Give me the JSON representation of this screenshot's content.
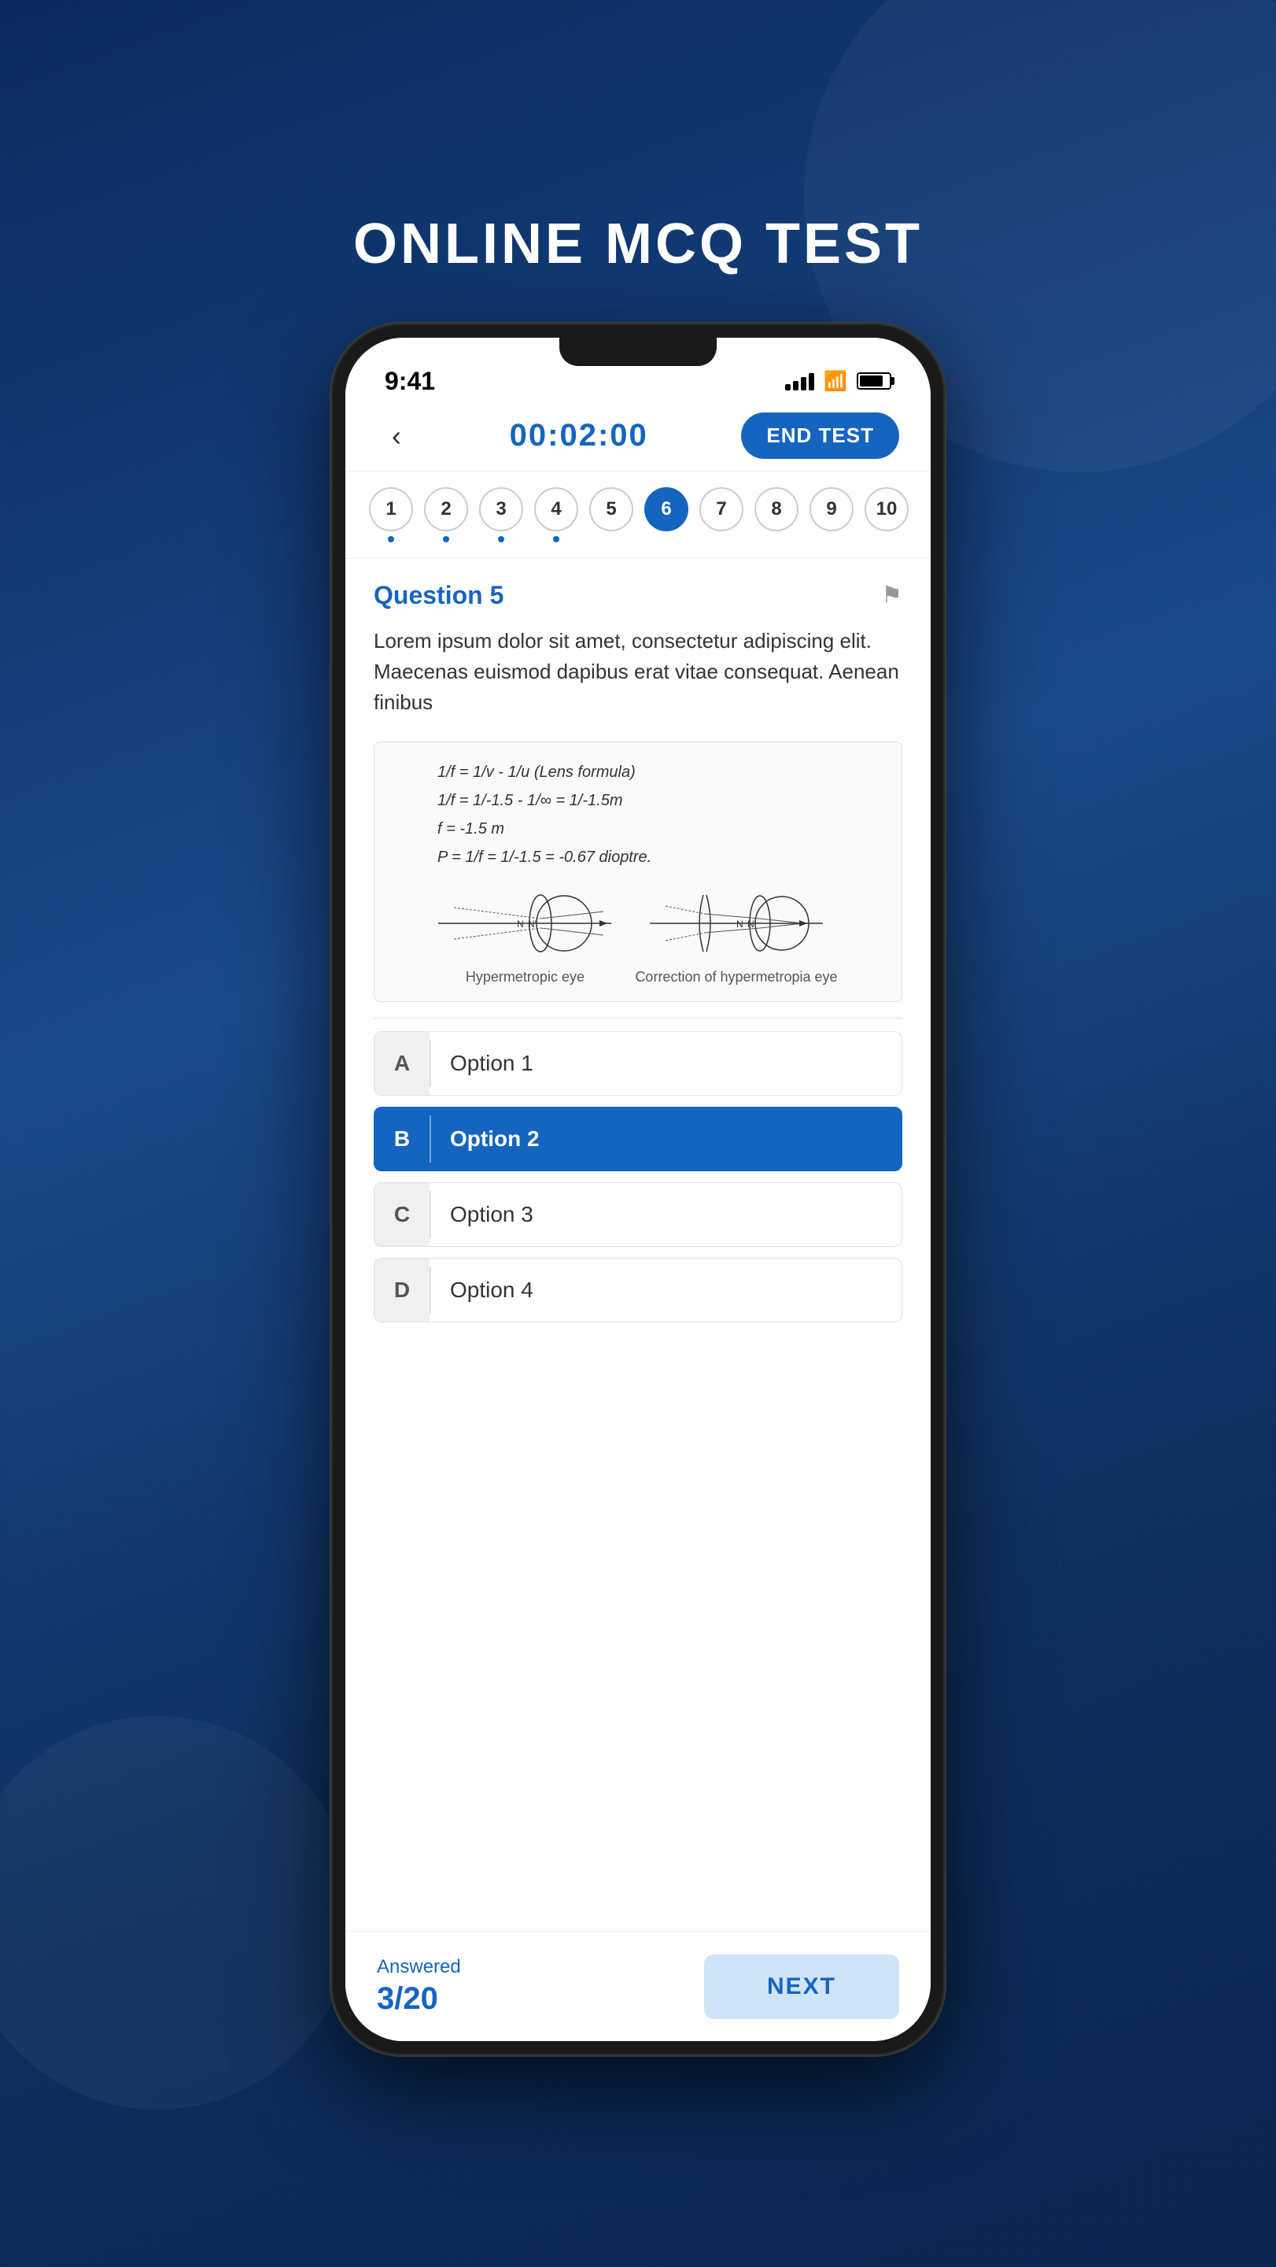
{
  "page": {
    "title": "ONLINE MCQ TEST"
  },
  "status_bar": {
    "time": "9:41"
  },
  "header": {
    "timer": "00:02:00",
    "end_test_label": "END TEST"
  },
  "question_numbers": {
    "items": [
      {
        "num": "1",
        "dot": true
      },
      {
        "num": "2",
        "dot": true
      },
      {
        "num": "3",
        "dot": true
      },
      {
        "num": "4",
        "dot": true
      },
      {
        "num": "5",
        "dot": false
      },
      {
        "num": "6",
        "dot": false,
        "active": true
      },
      {
        "num": "7",
        "dot": false
      },
      {
        "num": "8",
        "dot": false
      },
      {
        "num": "9",
        "dot": false
      },
      {
        "num": "10",
        "dot": false
      }
    ]
  },
  "question": {
    "title": "Question 5",
    "text": "Lorem ipsum dolor sit amet, consectetur adipiscing elit. Maecenas euismod dapibus erat vitae consequat. Aenean finibus",
    "formula_lines": [
      "1/f = 1/v - 1/u  (Lens formula)",
      "1/f = 1/-1.5 - 1/∞ = 1/-1.5m",
      "f = -1.5 m",
      "P = 1/f = 1/-1.5 = -0.67 dioptre."
    ],
    "diagram1_label": "Hypermetropic eye",
    "diagram2_label": "Correction of hypermetropia eye"
  },
  "options": [
    {
      "letter": "A",
      "text": "Option 1",
      "selected": false
    },
    {
      "letter": "B",
      "text": "Option 2",
      "selected": true
    },
    {
      "letter": "C",
      "text": "Option 3",
      "selected": false
    },
    {
      "letter": "D",
      "text": "Option 4",
      "selected": false
    }
  ],
  "footer": {
    "answered_label": "Answered",
    "answered_count": "3/20",
    "next_label": "NEXT"
  }
}
